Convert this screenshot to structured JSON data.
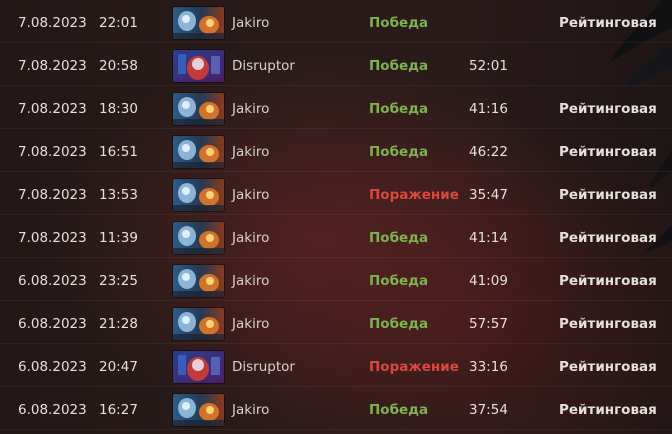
{
  "colors": {
    "win": "#7cb34f",
    "loss": "#d9493c"
  },
  "matches": [
    {
      "date": "7.08.2023",
      "time": "22:01",
      "hero": "Jakiro",
      "hero_icon": "jakiro-portrait-icon",
      "result": "Победа",
      "outcome": "win",
      "duration": "",
      "mode": "Рейтинговая"
    },
    {
      "date": "7.08.2023",
      "time": "20:58",
      "hero": "Disruptor",
      "hero_icon": "disruptor-portrait-icon",
      "result": "Победа",
      "outcome": "win",
      "duration": "52:01",
      "mode": ""
    },
    {
      "date": "7.08.2023",
      "time": "18:30",
      "hero": "Jakiro",
      "hero_icon": "jakiro-portrait-icon",
      "result": "Победа",
      "outcome": "win",
      "duration": "41:16",
      "mode": "Рейтинговая"
    },
    {
      "date": "7.08.2023",
      "time": "16:51",
      "hero": "Jakiro",
      "hero_icon": "jakiro-portrait-icon",
      "result": "Победа",
      "outcome": "win",
      "duration": "46:22",
      "mode": "Рейтинговая"
    },
    {
      "date": "7.08.2023",
      "time": "13:53",
      "hero": "Jakiro",
      "hero_icon": "jakiro-portrait-icon",
      "result": "Поражение",
      "outcome": "loss",
      "duration": "35:47",
      "mode": "Рейтинговая"
    },
    {
      "date": "7.08.2023",
      "time": "11:39",
      "hero": "Jakiro",
      "hero_icon": "jakiro-portrait-icon",
      "result": "Победа",
      "outcome": "win",
      "duration": "41:14",
      "mode": "Рейтинговая"
    },
    {
      "date": "6.08.2023",
      "time": "23:25",
      "hero": "Jakiro",
      "hero_icon": "jakiro-portrait-icon",
      "result": "Победа",
      "outcome": "win",
      "duration": "41:09",
      "mode": "Рейтинговая"
    },
    {
      "date": "6.08.2023",
      "time": "21:28",
      "hero": "Jakiro",
      "hero_icon": "jakiro-portrait-icon",
      "result": "Победа",
      "outcome": "win",
      "duration": "57:57",
      "mode": "Рейтинговая"
    },
    {
      "date": "6.08.2023",
      "time": "20:47",
      "hero": "Disruptor",
      "hero_icon": "disruptor-portrait-icon",
      "result": "Поражение",
      "outcome": "loss",
      "duration": "33:16",
      "mode": "Рейтинговая"
    },
    {
      "date": "6.08.2023",
      "time": "16:27",
      "hero": "Jakiro",
      "hero_icon": "jakiro-portrait-icon",
      "result": "Победа",
      "outcome": "win",
      "duration": "37:54",
      "mode": "Рейтинговая"
    }
  ]
}
